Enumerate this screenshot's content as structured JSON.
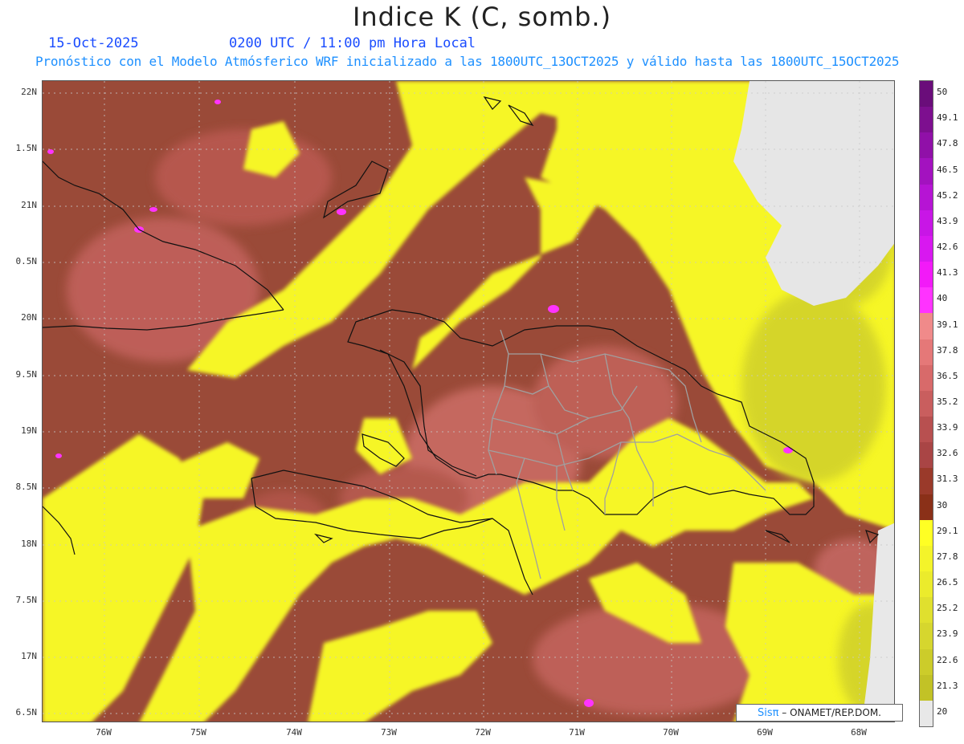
{
  "header": {
    "title": "Indice K (C, somb.)",
    "date": "15-Oct-2025",
    "time": "0200 UTC / 11:00 pm Hora Local",
    "model_info": "Pronóstico con el Modelo Atmósferico WRF inicializado a las 1800UTC_13OCT2025 y válido hasta las  1800UTC_15OCT2025"
  },
  "axes": {
    "lat_labels": [
      "22N",
      "1.5N",
      "21N",
      "0.5N",
      "20N",
      "9.5N",
      "19N",
      "8.5N",
      "18N",
      "7.5N",
      "17N",
      "6.5N"
    ],
    "lon_labels": [
      "76W",
      "75W",
      "74W",
      "73W",
      "72W",
      "71W",
      "70W",
      "69W",
      "68W"
    ]
  },
  "colorbar": {
    "levels": [
      "50",
      "49.1",
      "47.8",
      "46.5",
      "45.2",
      "43.9",
      "42.6",
      "41.3",
      "40",
      "39.1",
      "37.8",
      "36.5",
      "35.2",
      "33.9",
      "32.6",
      "31.3",
      "30",
      "29.1",
      "27.8",
      "26.5",
      "25.2",
      "23.9",
      "22.6",
      "21.3",
      "20"
    ],
    "colors": [
      "#6a0d7a",
      "#7d0f8f",
      "#9010a8",
      "#a312bf",
      "#b614d4",
      "#c816e6",
      "#d818f0",
      "#f21af8",
      "#ff33ff",
      "#f08a8a",
      "#e57878",
      "#d86a6a",
      "#c95e5e",
      "#b85050",
      "#a94545",
      "#9a3a2a",
      "#8a3018",
      "#ffff24",
      "#f4f42a",
      "#ebeb2c",
      "#e0e02e",
      "#d6d62e",
      "#cccc2a",
      "#c2c226",
      "#e8e8e8"
    ]
  },
  "credit": {
    "sis": "Sisπ",
    "org": " – ONAMET/REP.DOM."
  }
}
